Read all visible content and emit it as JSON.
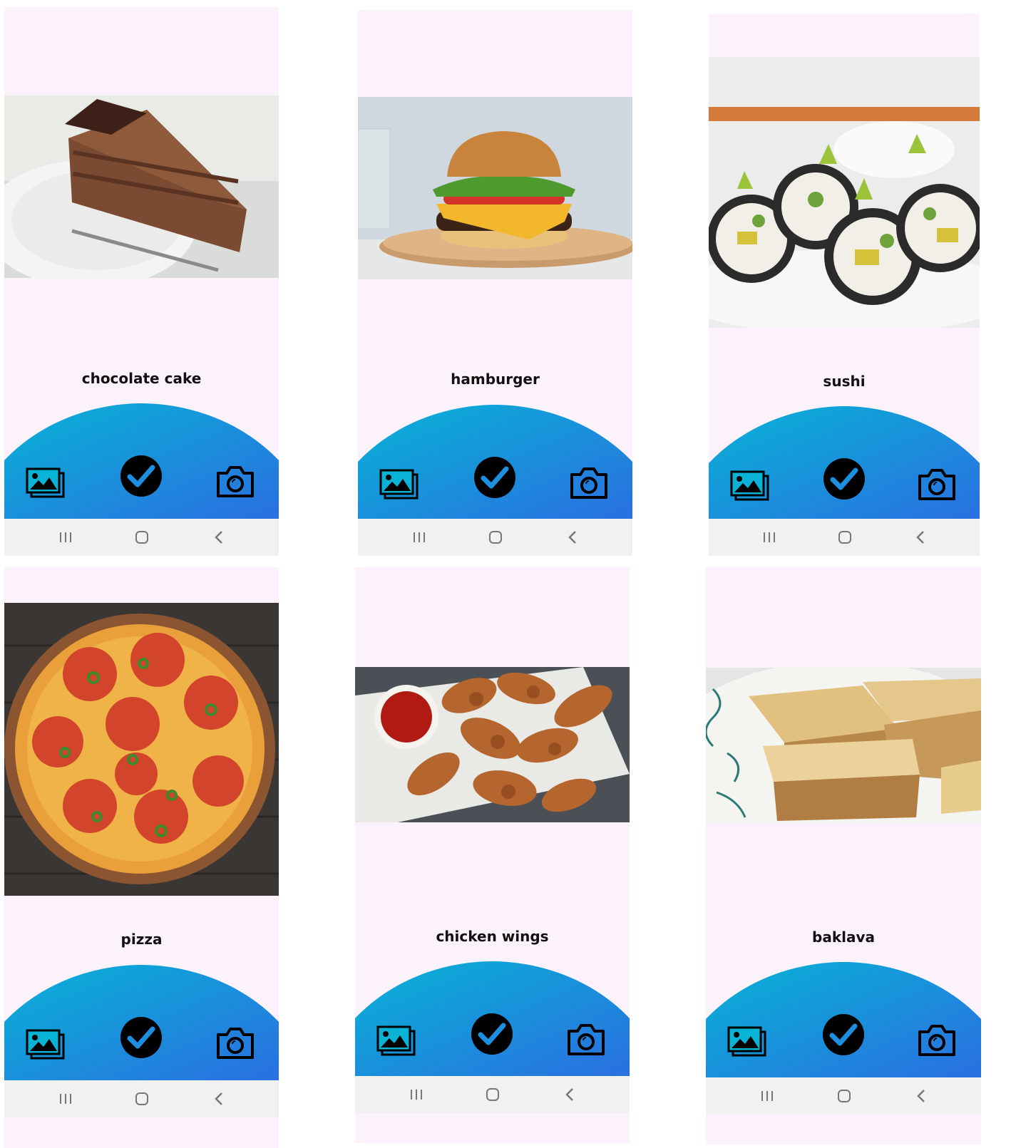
{
  "screens": [
    {
      "food_label": "chocolate cake",
      "photo_alt": "chocolate-cake-photo"
    },
    {
      "food_label": "hamburger",
      "photo_alt": "hamburger-photo"
    },
    {
      "food_label": "sushi",
      "photo_alt": "sushi-photo"
    },
    {
      "food_label": "pizza",
      "photo_alt": "pizza-photo"
    },
    {
      "food_label": "chicken wings",
      "photo_alt": "chicken-wings-photo"
    },
    {
      "food_label": "baklava",
      "photo_alt": "baklava-photo"
    }
  ],
  "actions": {
    "gallery_icon": "gallery-icon",
    "confirm_icon": "check-circle-icon",
    "camera_icon": "camera-icon"
  },
  "navigation": {
    "recents_icon": "recents-icon",
    "home_icon": "home-icon",
    "back_icon": "back-icon"
  },
  "colors": {
    "screen_background": "#fbf2fb",
    "arc_gradient_start": "#08b3d6",
    "arc_gradient_end": "#2a6fe0",
    "nav_background": "#f1f1f1"
  }
}
